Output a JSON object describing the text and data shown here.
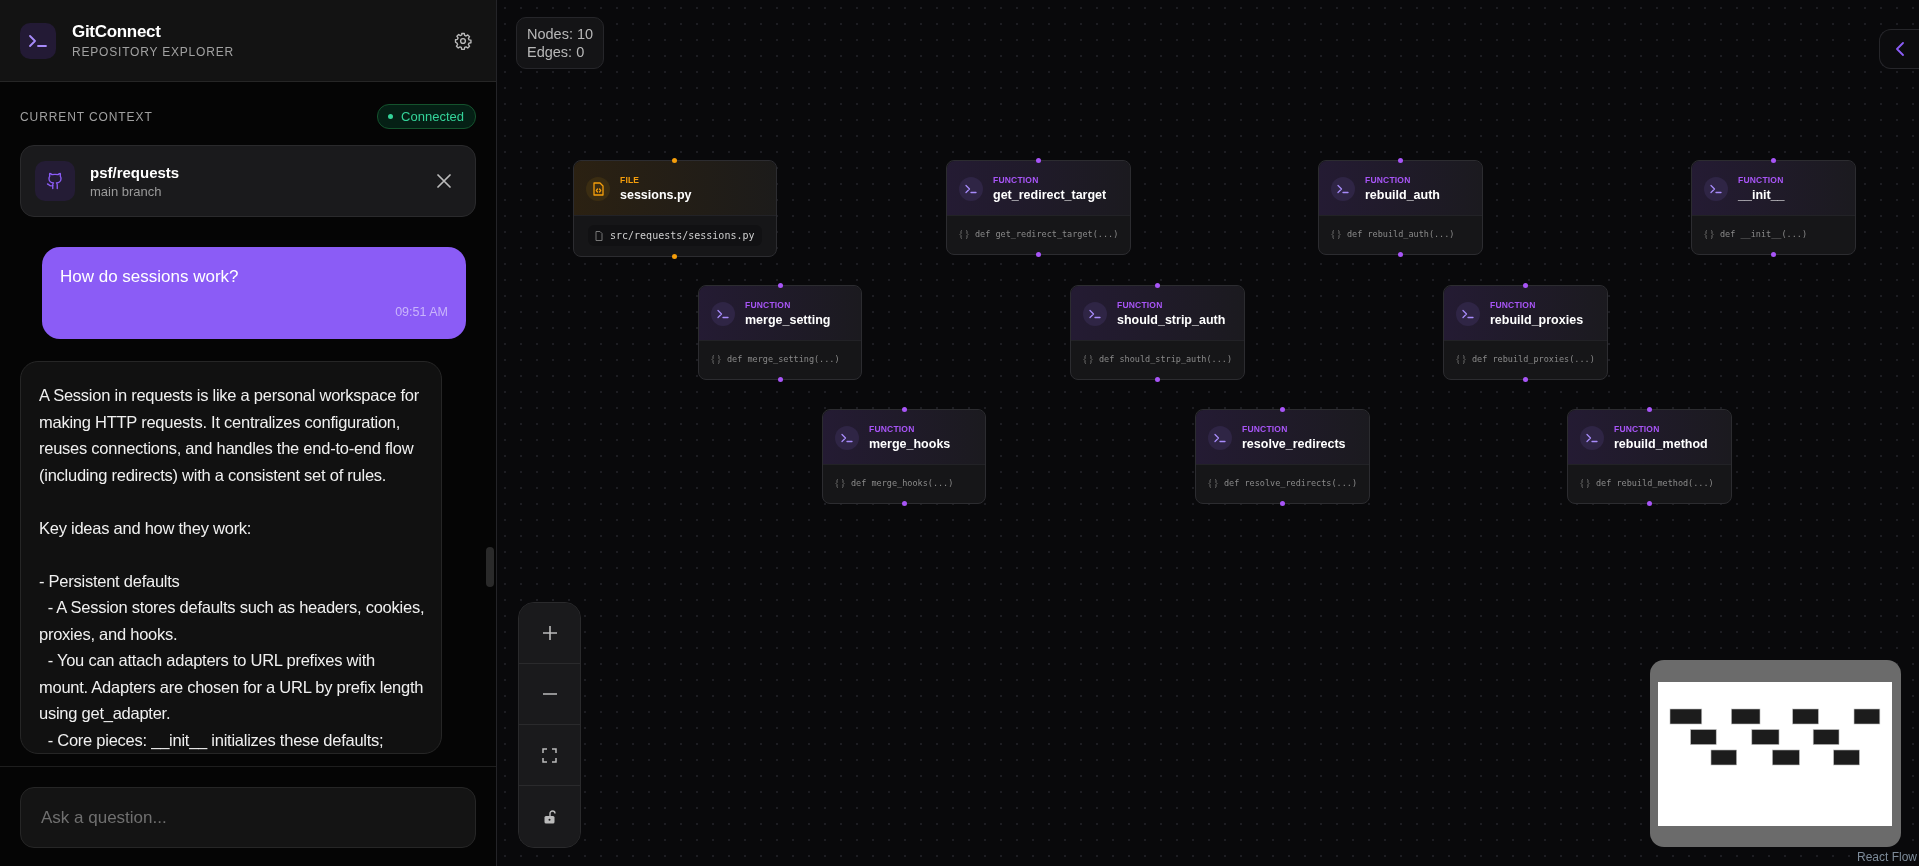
{
  "app": {
    "title": "GitConnect",
    "subtitle": "REPOSITORY EXPLORER"
  },
  "context": {
    "label": "CURRENT CONTEXT",
    "status": {
      "label": "Connected",
      "connected": true
    },
    "repo": {
      "name": "psf/requests",
      "branch": "main branch"
    }
  },
  "messages": [
    {
      "kind": "user",
      "text": "How do sessions work?",
      "time": "09:51 AM"
    },
    {
      "kind": "assistant",
      "text": "A Session in requests is like a personal workspace for making HTTP requests. It centralizes configuration, reuses connections, and handles the end-to-end flow (including redirects) with a consistent set of rules.\n\nKey ideas and how they work:\n\n- Persistent defaults\n  - A Session stores defaults such as headers, cookies, proxies, and hooks.\n  - You can attach adapters to URL prefixes with mount. Adapters are chosen for a URL by prefix length using get_adapter.\n  - Core pieces: __init__ initializes these defaults;"
    }
  ],
  "input": {
    "placeholder": "Ask a question..."
  },
  "stats": {
    "nodes": "Nodes: 10",
    "edges": "Edges: 0"
  },
  "nodes": [
    {
      "kind": "file",
      "type_label": "FILE",
      "name": "sessions.py",
      "path": "src/requests/sessions.py"
    },
    {
      "kind": "function",
      "type_label": "FUNCTION",
      "name": "get_redirect_target",
      "signature": "def get_redirect_target(...)"
    },
    {
      "kind": "function",
      "type_label": "FUNCTION",
      "name": "rebuild_auth",
      "signature": "def rebuild_auth(...)"
    },
    {
      "kind": "function",
      "type_label": "FUNCTION",
      "name": "__init__",
      "signature": "def __init__(...)"
    },
    {
      "kind": "function",
      "type_label": "FUNCTION",
      "name": "merge_setting",
      "signature": "def merge_setting(...)"
    },
    {
      "kind": "function",
      "type_label": "FUNCTION",
      "name": "should_strip_auth",
      "signature": "def should_strip_auth(...)"
    },
    {
      "kind": "function",
      "type_label": "FUNCTION",
      "name": "rebuild_proxies",
      "signature": "def rebuild_proxies(...)"
    },
    {
      "kind": "function",
      "type_label": "FUNCTION",
      "name": "merge_hooks",
      "signature": "def merge_hooks(...)"
    },
    {
      "kind": "function",
      "type_label": "FUNCTION",
      "name": "resolve_redirects",
      "signature": "def resolve_redirects(...)"
    },
    {
      "kind": "function",
      "type_label": "FUNCTION",
      "name": "rebuild_method",
      "signature": "def rebuild_method(...)"
    }
  ],
  "attribution": "React Flow"
}
